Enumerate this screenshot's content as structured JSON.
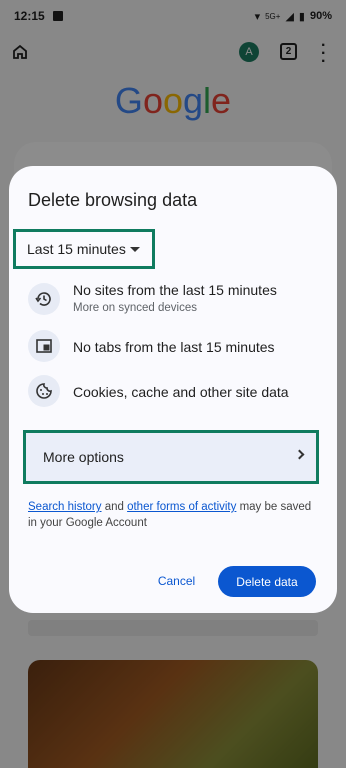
{
  "status_bar": {
    "time": "12:15",
    "network": "5G+",
    "battery": "90%"
  },
  "browser": {
    "avatar_letter": "A",
    "tab_count": "2",
    "logo": [
      "G",
      "o",
      "o",
      "g",
      "l",
      "e"
    ]
  },
  "colors": {
    "accent": "#0b57d0",
    "highlight_border": "#0f7b5f",
    "logo": [
      "#4285F4",
      "#EA4335",
      "#FBBC05",
      "#4285F4",
      "#34A853",
      "#EA4335"
    ]
  },
  "dialog": {
    "title": "Delete browsing data",
    "time_range": "Last 15 minutes",
    "items": [
      {
        "icon": "history-icon",
        "title": "No sites from the last 15 minutes",
        "subtitle": "More on synced devices"
      },
      {
        "icon": "tab-icon",
        "title": "No tabs from the last 15 minutes"
      },
      {
        "icon": "cookie-icon",
        "title": "Cookies, cache and other site data"
      }
    ],
    "more_options": "More options",
    "footnote": {
      "link1": "Search history",
      "text1": " and ",
      "link2": "other forms of activity",
      "text2": " may be saved in your Google Account"
    },
    "cancel": "Cancel",
    "delete": "Delete data"
  }
}
